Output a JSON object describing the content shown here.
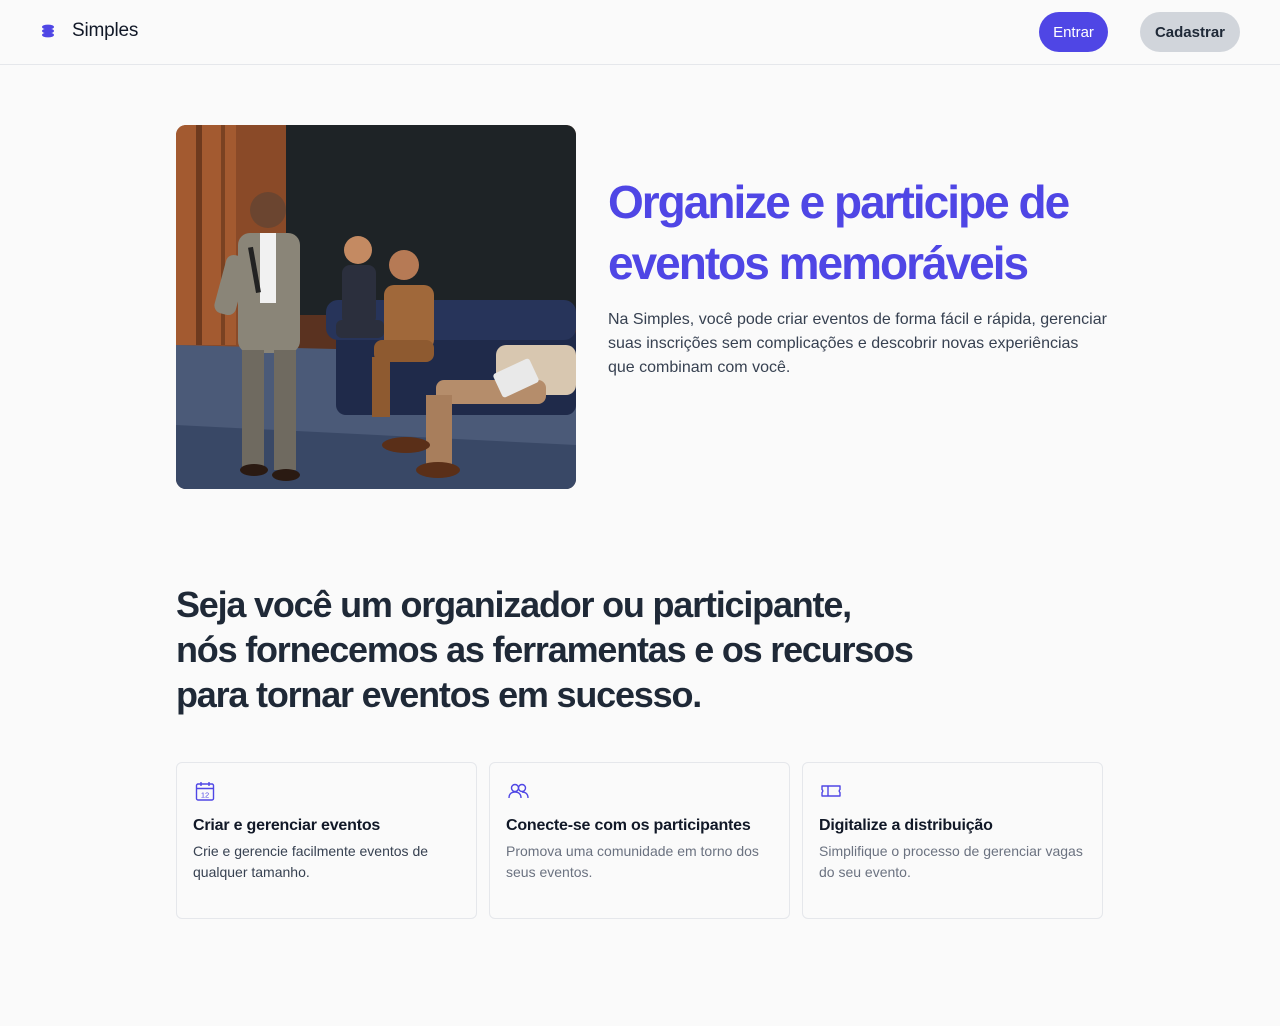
{
  "header": {
    "brand": "Simples",
    "login_label": "Entrar",
    "signup_label": "Cadastrar"
  },
  "hero": {
    "title": "Organize e participe de eventos memoráveis",
    "description": "Na Simples, você pode criar eventos de forma fácil e rápida, gerenciar suas inscrições sem complicações e descobrir novas experiências que combinam com você."
  },
  "section": {
    "title": "Seja você um organizador ou participante, nós fornecemos as ferramentas e os recursos para tornar eventos em sucesso."
  },
  "features": [
    {
      "icon": "calendar-icon",
      "icon_text": "12",
      "title": "Criar e gerenciar eventos",
      "description": "Crie e gerencie facilmente eventos de qualquer tamanho."
    },
    {
      "icon": "users-icon",
      "title": "Conecte-se com os participantes",
      "description": "Promova uma comunidade  em torno dos seus eventos."
    },
    {
      "icon": "ticket-icon",
      "title": "Digitalize a distribuição",
      "description": "Simplifique o processo de gerenciar vagas do seu evento."
    }
  ],
  "colors": {
    "accent": "#4f46e5",
    "text_dark": "#1f2937",
    "text_muted": "#6b7280",
    "border": "#e5e7eb",
    "background": "#fafafa"
  }
}
